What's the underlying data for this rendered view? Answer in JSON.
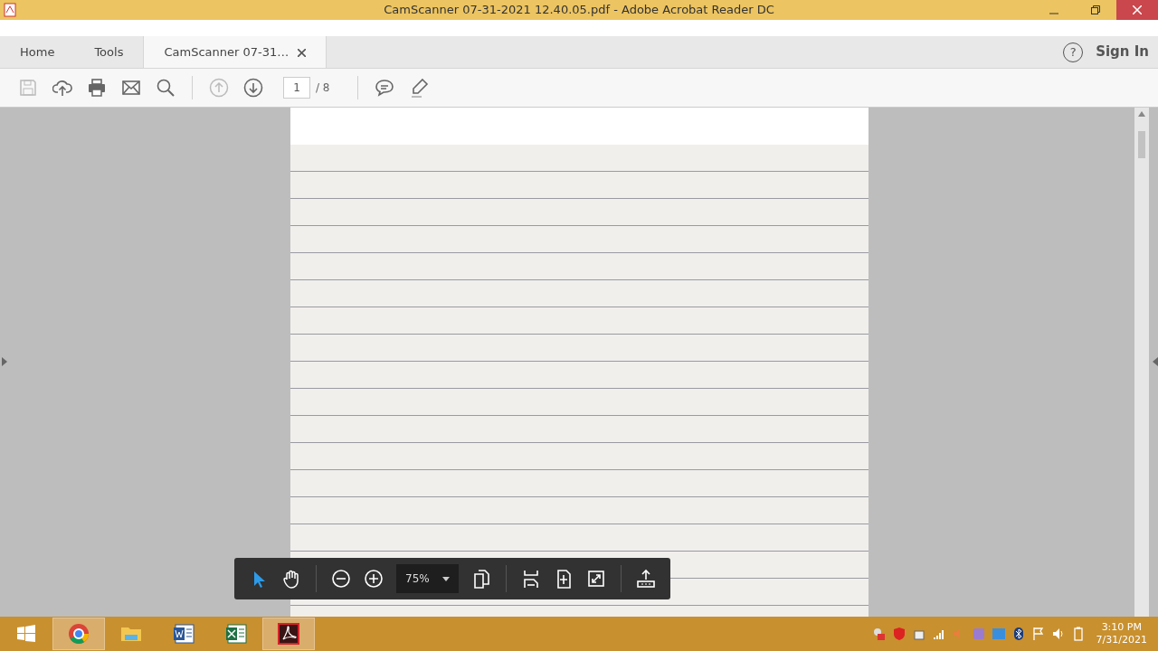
{
  "window": {
    "title": "CamScanner 07-31-2021 12.40.05.pdf - Adobe Acrobat Reader DC"
  },
  "tabs": [
    {
      "label": "Home",
      "selected": false,
      "closable": false
    },
    {
      "label": "Tools",
      "selected": false,
      "closable": false
    },
    {
      "label": "CamScanner 07-31…",
      "selected": true,
      "closable": true
    }
  ],
  "account": {
    "help": "?",
    "sign_in": "Sign In"
  },
  "toolbar": {
    "page_current": "1",
    "page_total": "/ 8"
  },
  "floating_toolbar": {
    "tools": [
      {
        "kind": "select",
        "selected": true
      },
      {
        "kind": "hand",
        "selected": false
      }
    ],
    "zoom": "75%"
  },
  "taskbar": {
    "apps": [
      {
        "kind": "chrome",
        "running": true
      },
      {
        "kind": "explorer",
        "running": false
      },
      {
        "kind": "word",
        "running": false
      },
      {
        "kind": "excel",
        "running": false
      },
      {
        "kind": "acrobat",
        "running": true
      }
    ],
    "time": "3:10 PM",
    "date": "7/31/2021"
  }
}
